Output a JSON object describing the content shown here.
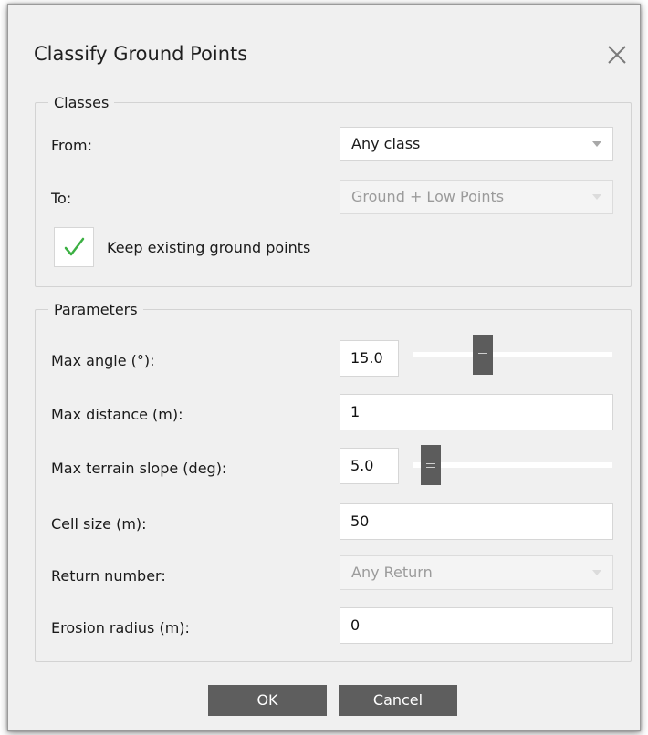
{
  "dialog": {
    "title": "Classify Ground Points",
    "close_icon": "close-icon"
  },
  "classes": {
    "legend": "Classes",
    "from_label": "From:",
    "from_value": "Any class",
    "to_label": "To:",
    "to_value": "Ground + Low Points",
    "to_enabled": false,
    "keep_label": "Keep existing ground points",
    "keep_checked": true,
    "check_color": "#3cb043"
  },
  "parameters": {
    "legend": "Parameters",
    "max_angle_label": "Max angle (°):",
    "max_angle_value": "15.0",
    "max_angle_slider_fraction": 0.34,
    "max_distance_label": "Max distance (m):",
    "max_distance_value": "1",
    "max_slope_label": "Max terrain slope (deg):",
    "max_slope_value": "5.0",
    "max_slope_slider_fraction": 0.05,
    "cell_size_label": "Cell size (m):",
    "cell_size_value": "50",
    "return_label": "Return number:",
    "return_value": "Any Return",
    "return_enabled": false,
    "erosion_label": "Erosion radius (m):",
    "erosion_value": "0"
  },
  "buttons": {
    "ok": "OK",
    "cancel": "Cancel"
  }
}
